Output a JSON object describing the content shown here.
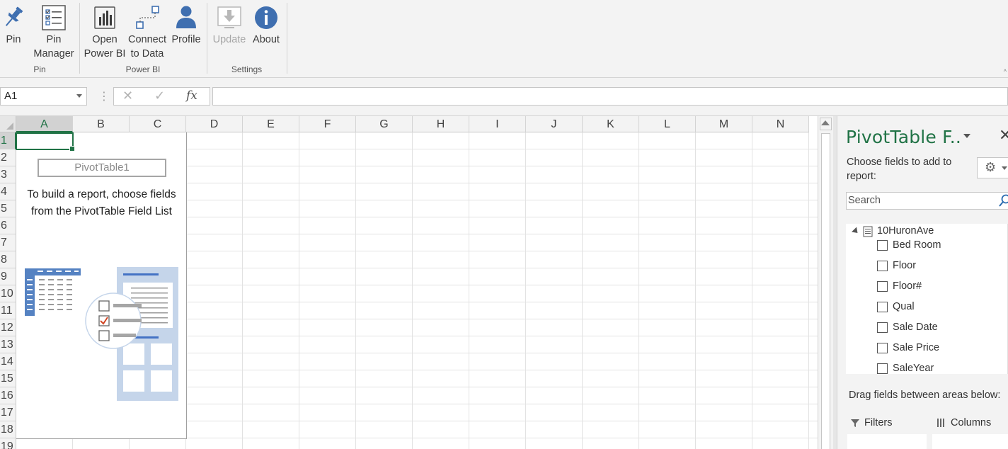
{
  "ribbon": {
    "buttons": [
      {
        "id": "pin",
        "label": "Pin",
        "icon": "pin-icon"
      },
      {
        "id": "pin_manager",
        "label": "Pin\nManager",
        "icon": "checklist-icon"
      },
      {
        "id": "open_power_bi",
        "label": "Open\nPower BI",
        "icon": "power-bi-icon"
      },
      {
        "id": "connect_to_data",
        "label": "Connect\nto Data",
        "icon": "connect-data-icon"
      },
      {
        "id": "profile",
        "label": "Profile",
        "icon": "user-icon"
      },
      {
        "id": "update",
        "label": "Update",
        "icon": "update-icon",
        "disabled": true
      },
      {
        "id": "about",
        "label": "About",
        "icon": "info-icon"
      }
    ],
    "groups": [
      "Pin",
      "Power BI",
      "Settings"
    ]
  },
  "formula_bar": {
    "name_box": "A1",
    "cancel_icon": "cancel-icon",
    "enter_icon": "check-icon",
    "fx_label": "fx",
    "value": ""
  },
  "grid": {
    "columns": [
      "A",
      "B",
      "C",
      "D",
      "E",
      "F",
      "G",
      "H",
      "I",
      "J",
      "K",
      "L",
      "M",
      "N"
    ],
    "rows": [
      "1",
      "2",
      "3",
      "4",
      "5",
      "6",
      "7",
      "8",
      "9",
      "10",
      "11",
      "12",
      "13",
      "14",
      "15",
      "16",
      "17",
      "18",
      "19"
    ],
    "active_cell": "A1"
  },
  "pivot_placeholder": {
    "name": "PivotTable1",
    "message": "To build a report, choose fields\nfrom the PivotTable Field List"
  },
  "field_pane": {
    "title": "PivotTable F..",
    "subtitle": "Choose fields to add to report:",
    "search_placeholder": "Search",
    "table_name": "10HuronAve",
    "fields": [
      "Bed Room",
      "Floor",
      "Floor#",
      "Qual",
      "Sale Date",
      "Sale Price",
      "SaleYear"
    ],
    "drag_label": "Drag fields between areas below:",
    "areas": [
      "Filters",
      "Columns"
    ]
  },
  "colors": {
    "excel_green": "#217346",
    "power_bi_blue": "#3f6fb0",
    "ribbon_bg": "#f3f3f3"
  }
}
